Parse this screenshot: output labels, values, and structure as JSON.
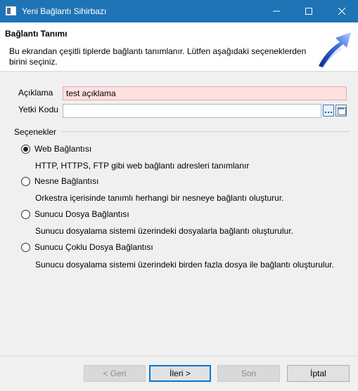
{
  "window": {
    "title": "Yeni Bağlantı Sihirbazı",
    "titlebar_color": "#1f74b5"
  },
  "header": {
    "title": "Bağlantı Tanımı",
    "description": "Bu ekrandan çeşitli tiplerde bağlantı tanımlanır. Lütfen aşağıdaki seçeneklerden birini seçiniz.",
    "banner_icon": "wizard-arrow-icon"
  },
  "fields": {
    "description_label": "Açıklama",
    "description_value": "test açıklama",
    "auth_code_label": "Yetki Kodu",
    "auth_code_value": ""
  },
  "options": {
    "group_title": "Seçenekler",
    "items": [
      {
        "label": "Web Bağlantısı",
        "description": "HTTP, HTTPS, FTP gibi web bağlantı adresleri tanımlanır",
        "selected": true
      },
      {
        "label": "Nesne Bağlantısı",
        "description": "Orkestra içerisinde tanımlı herhangi bir nesneye bağlantı oluşturur.",
        "selected": false
      },
      {
        "label": "Sunucu Dosya Bağlantısı",
        "description": "Sunucu dosyalama sistemi üzerindeki dosyalarla bağlantı oluşturulur.",
        "selected": false
      },
      {
        "label": "Sunucu Çoklu Dosya Bağlantısı",
        "description": "Sunucu dosyalama sistemi üzerindeki birden fazla dosya ile bağlantı oluşturulur.",
        "selected": false
      }
    ]
  },
  "buttons": {
    "back": "< Geri",
    "next": "İleri >",
    "finish": "Son",
    "cancel": "İptal"
  }
}
